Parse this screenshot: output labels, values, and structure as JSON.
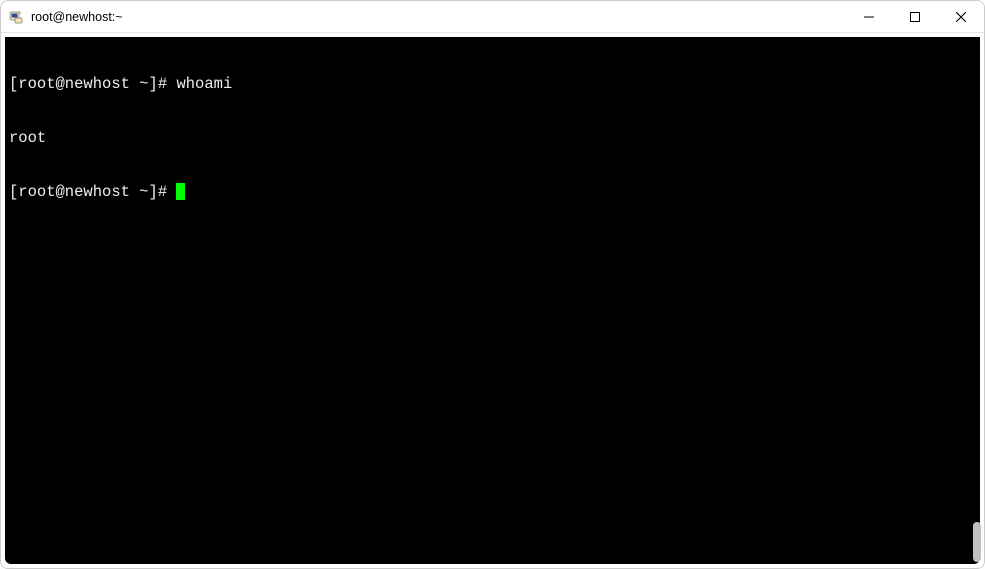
{
  "window": {
    "title": "root@newhost:~"
  },
  "terminal": {
    "lines": [
      {
        "prompt": "[root@newhost ~]# ",
        "command": "whoami"
      },
      {
        "output": "root"
      },
      {
        "prompt": "[root@newhost ~]# ",
        "cursor": true
      }
    ]
  }
}
